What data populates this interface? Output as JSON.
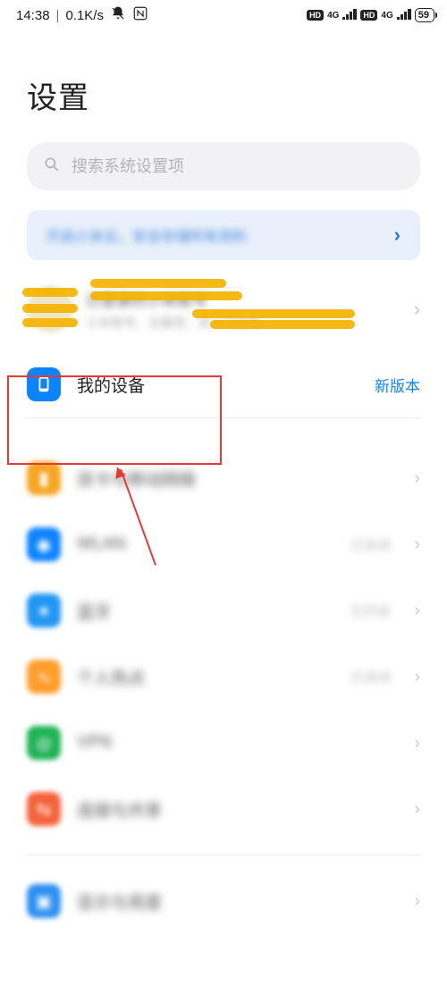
{
  "status": {
    "time": "14:38",
    "net_speed": "0.1K/s",
    "battery_pct": "59"
  },
  "page": {
    "title": "设置"
  },
  "search": {
    "placeholder": "搜索系统设置项"
  },
  "banner": {
    "text": "开启小米云，安全存储所有资料"
  },
  "account": {
    "line1": "已登录的小米账号",
    "line2": "小米账号、云服务、家人共享等"
  },
  "my_device": {
    "label": "我的设备",
    "badge": "新版本",
    "icon_color": "#0d84ff"
  },
  "rows": [
    {
      "key": "sim",
      "label": "双卡与移动网络",
      "icon_color": "#f5a623",
      "status": ""
    },
    {
      "key": "wlan",
      "label": "WLAN",
      "icon_color": "#0d84ff",
      "status": "已关闭"
    },
    {
      "key": "bt",
      "label": "蓝牙",
      "icon_color": "#2196f3",
      "status": "已开启"
    },
    {
      "key": "hotspot",
      "label": "个人热点",
      "icon_color": "#ff9e2c",
      "status": "已关闭"
    },
    {
      "key": "vpn",
      "label": "VPN",
      "icon_color": "#1fb356",
      "status": ""
    },
    {
      "key": "share",
      "label": "连接与共享",
      "icon_color": "#f4623a",
      "status": ""
    }
  ],
  "rows2": [
    {
      "key": "tethering",
      "label": "显示与亮度",
      "icon_color": "#2c90f0",
      "status": ""
    }
  ]
}
